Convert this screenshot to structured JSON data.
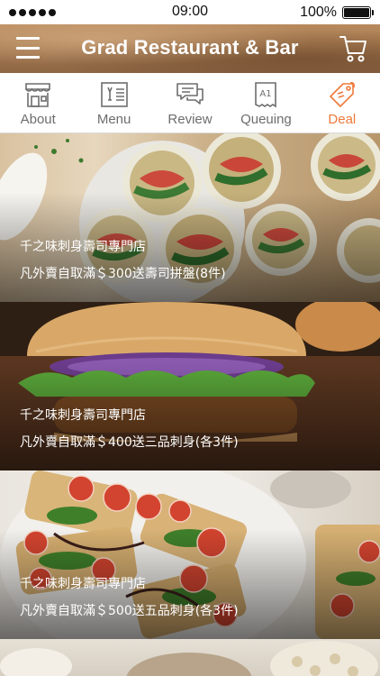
{
  "status_bar": {
    "time": "09:00",
    "battery": "100%",
    "battery_level": 1.0
  },
  "header": {
    "title": "Grad Restaurant & Bar"
  },
  "tabs": [
    {
      "label": "About",
      "icon": "storefront-icon",
      "active": false
    },
    {
      "label": "Menu",
      "icon": "menu-book-icon",
      "active": false
    },
    {
      "label": "Review",
      "icon": "chat-bubbles-icon",
      "active": false
    },
    {
      "label": "Queuing",
      "icon": "ticket-icon",
      "active": false
    },
    {
      "label": "Deal",
      "icon": "tag-icon",
      "active": true
    }
  ],
  "colors": {
    "accent": "#ee7a3a",
    "tab_inactive": "#6d6d6d"
  },
  "deals": [
    {
      "name": "千之味刺身壽司專門店",
      "offer": "凡外賣自取滿＄300送壽司拼盤(8件)",
      "image": "wrap-rolls-image"
    },
    {
      "name": "千之味刺身壽司專門店",
      "offer": "凡外賣自取滿＄400送三品刺身(各3件)",
      "image": "burger-image"
    },
    {
      "name": "千之味刺身壽司專門店",
      "offer": "凡外賣自取滿＄500送五品刺身(各3件)",
      "image": "bruschetta-image"
    }
  ]
}
